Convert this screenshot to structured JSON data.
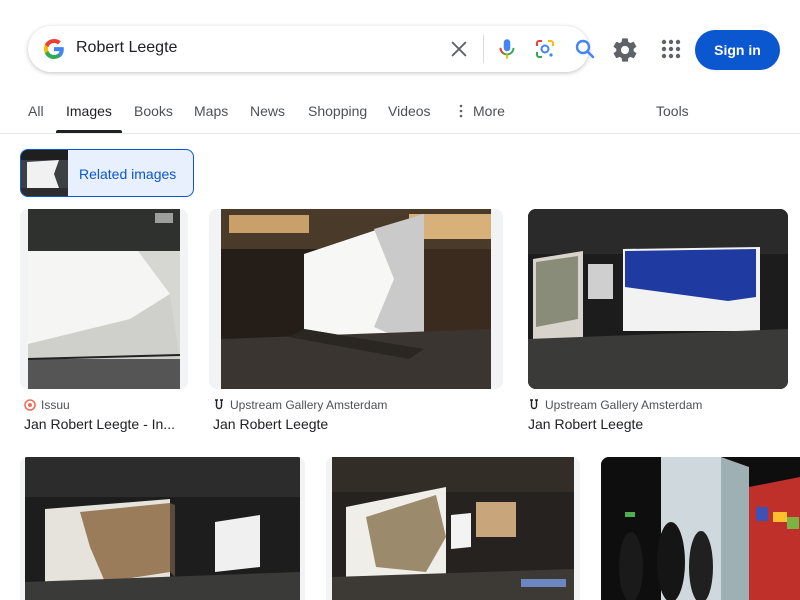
{
  "search": {
    "query": "Robert Leegte"
  },
  "header": {
    "signin_label": "Sign in"
  },
  "tabs": [
    {
      "label": "All"
    },
    {
      "label": "Images"
    },
    {
      "label": "Books"
    },
    {
      "label": "Maps"
    },
    {
      "label": "News"
    },
    {
      "label": "Shopping"
    },
    {
      "label": "Videos"
    },
    {
      "label": "More"
    },
    {
      "label": "Tools"
    }
  ],
  "related": {
    "label": "Related images"
  },
  "results": [
    {
      "source": "Issuu",
      "title": "Jan Robert Leegte - In...",
      "source_icon": "issuu-icon"
    },
    {
      "source": "Upstream Gallery Amsterdam",
      "title": "Jan Robert Leegte",
      "source_icon": "upstream-u-icon"
    },
    {
      "source": "Upstream Gallery Amsterdam",
      "title": "Jan Robert Leegte",
      "source_icon": "upstream-u-icon"
    }
  ],
  "colors": {
    "accent": "#0b57d0",
    "google_blue": "#4285f4",
    "google_red": "#ea4335",
    "google_yellow": "#fbbc05",
    "google_green": "#34a853"
  }
}
